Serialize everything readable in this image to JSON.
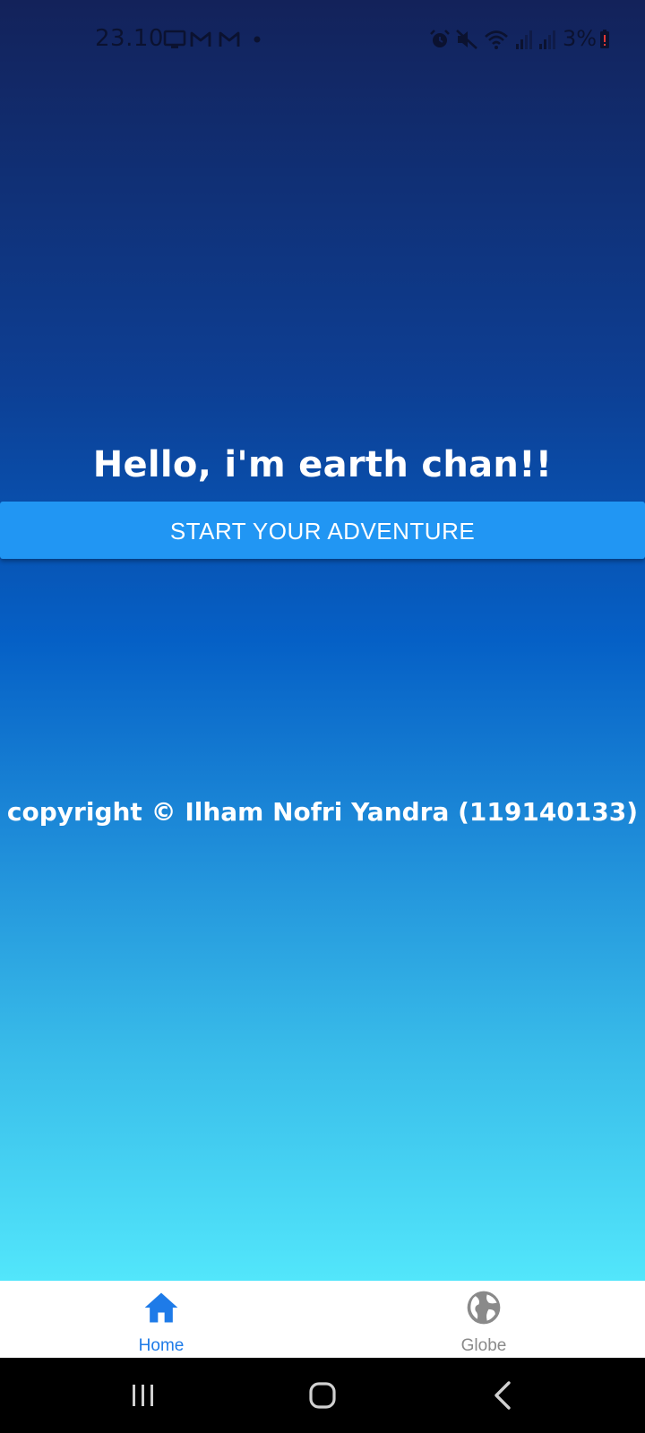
{
  "status_bar": {
    "time": "23.10",
    "battery_percent": "3%",
    "icons": [
      "screen-mirror-icon",
      "gmail-icon",
      "gmail-icon",
      "notification-dot-icon",
      "alarm-icon",
      "mute-icon",
      "wifi-icon",
      "signal-icon",
      "signal-icon",
      "battery-low-icon"
    ]
  },
  "main": {
    "title": "Hello, i'm earth chan!!",
    "start_button_label": "START YOUR ADVENTURE",
    "copyright": "copyright © Ilham Nofri Yandra (119140133)"
  },
  "bottom_nav": {
    "items": [
      {
        "label": "Home",
        "icon": "home-icon",
        "active": true
      },
      {
        "label": "Globe",
        "icon": "globe-icon",
        "active": false
      }
    ]
  },
  "colors": {
    "accent": "#2196f3",
    "nav_active": "#1e7be8",
    "nav_inactive": "#8a8a8a",
    "gradient_top": "#13225a",
    "gradient_bottom": "#52e6fb"
  },
  "system_nav": {
    "buttons": [
      "recent-apps-icon",
      "home-circle-icon",
      "back-icon"
    ]
  }
}
